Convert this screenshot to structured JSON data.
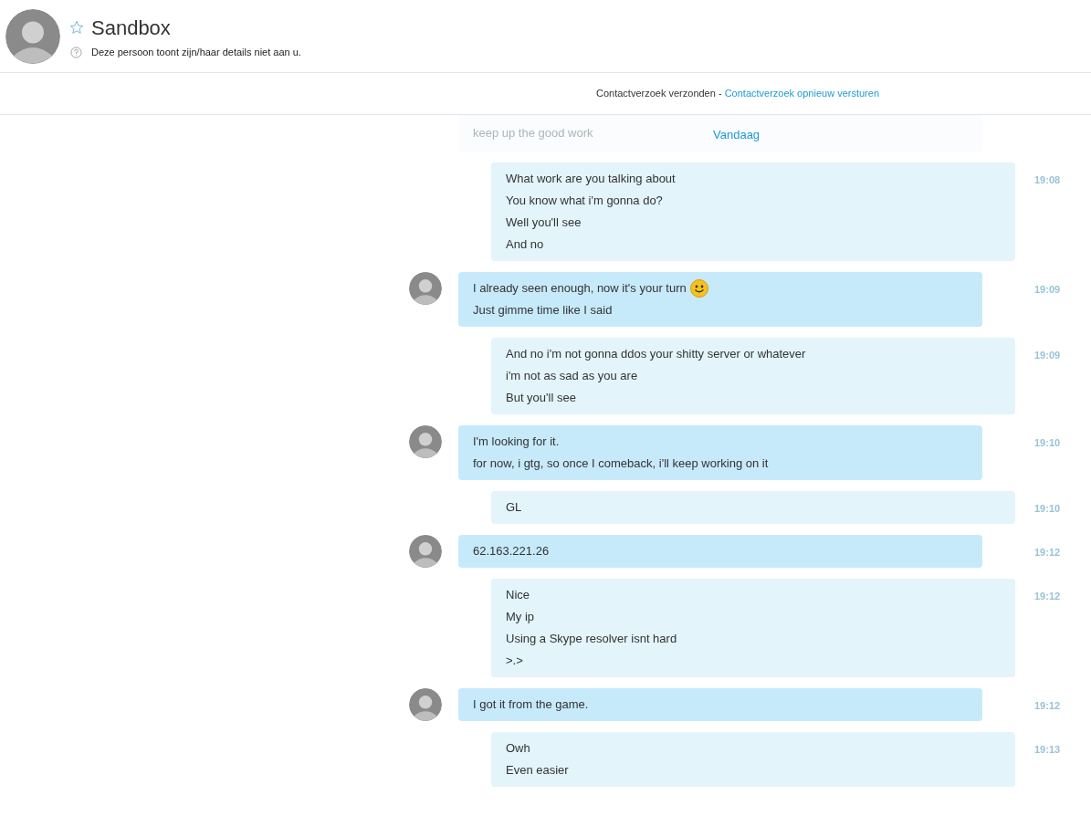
{
  "contact": {
    "name": "Sandbox",
    "favorite": false,
    "status": "Deze persoon toont zijn/haar details niet aan u."
  },
  "request_bar": {
    "text": "Contactverzoek verzonden - ",
    "link": "Contactverzoek opnieuw versturen"
  },
  "faded_message": "keep up the good work",
  "date_divider": "Vandaag",
  "messages": [
    {
      "kind": "sent",
      "time": "19:08",
      "emoji_on_first_line": false,
      "lines": [
        "What work are you talking about",
        "You know what i'm gonna do?",
        "Well you'll see",
        "And no"
      ]
    },
    {
      "kind": "received",
      "time": "19:09",
      "emoji_on_first_line": true,
      "lines": [
        "I already seen enough, now it's your turn",
        "Just gimme time like I said"
      ]
    },
    {
      "kind": "sent",
      "time": "19:09",
      "emoji_on_first_line": false,
      "lines": [
        "And no i'm not gonna ddos your shitty server or whatever",
        "i'm not as sad as you are",
        "But you'll see"
      ]
    },
    {
      "kind": "received",
      "time": "19:10",
      "emoji_on_first_line": false,
      "lines": [
        "I'm looking for it.",
        "for now, i gtg, so once I comeback, i'll keep working on it"
      ]
    },
    {
      "kind": "sent",
      "time": "19:10",
      "emoji_on_first_line": false,
      "lines": [
        "GL"
      ]
    },
    {
      "kind": "received",
      "time": "19:12",
      "emoji_on_first_line": false,
      "lines": [
        "62.163.221.26"
      ]
    },
    {
      "kind": "sent",
      "time": "19:12",
      "emoji_on_first_line": false,
      "lines": [
        "Nice",
        "My ip",
        "Using a Skype resolver isnt hard",
        ">.>"
      ]
    },
    {
      "kind": "received",
      "time": "19:12",
      "emoji_on_first_line": false,
      "lines": [
        "I got it from the game."
      ]
    },
    {
      "kind": "sent",
      "time": "19:13",
      "emoji_on_first_line": false,
      "lines": [
        "Owh",
        "Even easier"
      ]
    }
  ]
}
